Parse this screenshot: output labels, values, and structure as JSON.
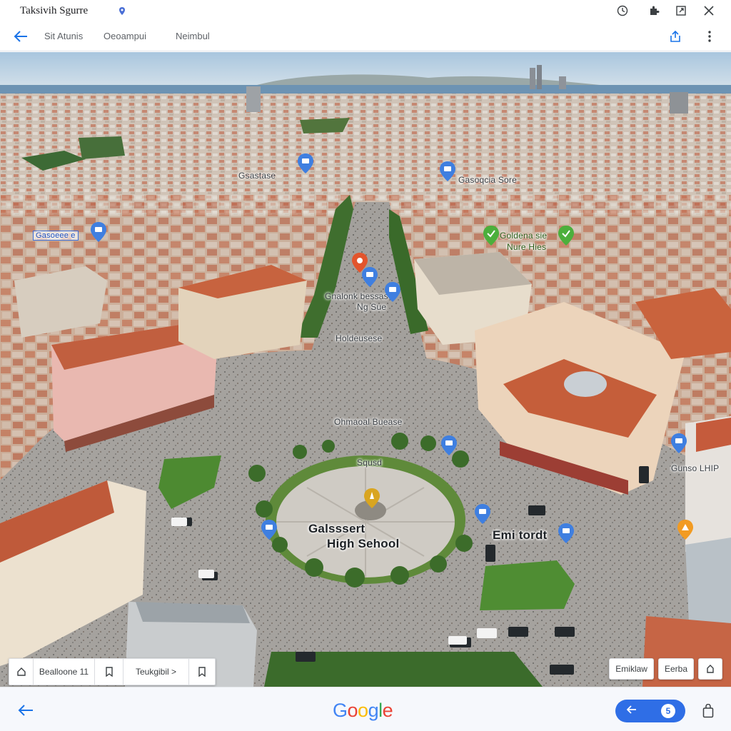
{
  "window": {
    "title": "Taksivih Sgurre"
  },
  "toolbar": {
    "tabs": [
      "Sit Atunis",
      "Oeoampui",
      "Neimbul"
    ]
  },
  "map": {
    "place_labels": [
      "Gsastase",
      "Gasoeee e",
      "Gasoqcia Sore",
      "Goldena sie",
      "Nure Hies",
      "Gnalonk bessas",
      "Ng Sue",
      "Holdeusese",
      "Ohmaoal Buease",
      "Squsd",
      "Galsssert",
      "High Sehool",
      "Emi tordt",
      "Gunso LHIP"
    ]
  },
  "chips_left": [
    "Bealloone 11",
    "Teukgibil >"
  ],
  "chips_right": [
    "Emiklaw",
    "Eerba"
  ],
  "bottom": {
    "logo_letters": [
      "G",
      "o",
      "o",
      "g",
      "l",
      "e"
    ],
    "counter": "5"
  },
  "colors": {
    "pin_blue": "#3f7fe0",
    "pin_red": "#e2552d",
    "pin_green": "#4caf3c",
    "pin_orange": "#f29b22",
    "pin_gold": "#d9a520",
    "accent": "#2f6ee6",
    "logo": [
      "#4285f4",
      "#ea4335",
      "#fbbc05",
      "#4285f4",
      "#34a853",
      "#ea4335"
    ]
  },
  "icons": {
    "title_mark": "location-dot-icon",
    "history": "clock-icon",
    "puzzle": "extension-icon",
    "new_window": "open-window-icon",
    "close": "close-icon",
    "back": "arrow-left-icon",
    "share": "share-icon",
    "more": "more-vert-icon",
    "home": "home-icon",
    "bookmark": "bookmark-icon",
    "fullscreen": "fullscreen-icon",
    "save": "save-bag-icon"
  }
}
